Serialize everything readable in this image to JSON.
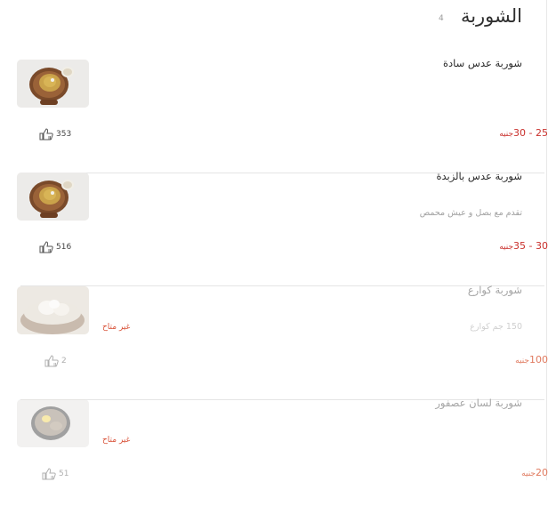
{
  "section": {
    "title": "الشوربة",
    "count": "4"
  },
  "items": [
    {
      "name": "شوربة عدس سادة",
      "description": "",
      "price": "25 - 30",
      "currency": "جنيه",
      "likes": "353",
      "available": true,
      "status_label": ""
    },
    {
      "name": "شوربة عدس بالزبدة",
      "description": "تقدم مع بصل و عيش محمص",
      "price": "30 - 35",
      "currency": "جنيه",
      "likes": "516",
      "available": true,
      "status_label": ""
    },
    {
      "name": "شوربة كوارع",
      "description": "150 جم كوارع",
      "price": "100",
      "currency": "جنيه",
      "likes": "2",
      "available": false,
      "status_label": "غير متاح"
    },
    {
      "name": "شوربة لسان عصفور",
      "description": "",
      "price": "20",
      "currency": "جنيه",
      "likes": "51",
      "available": false,
      "status_label": "غير متاح"
    }
  ]
}
